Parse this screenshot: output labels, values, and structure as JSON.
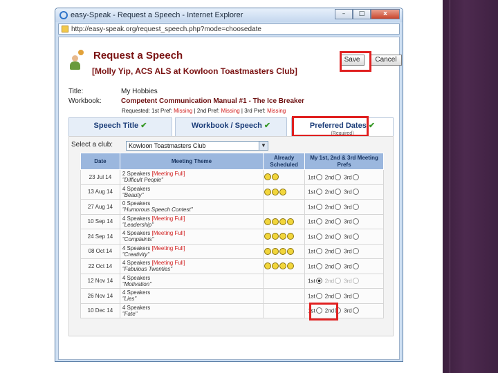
{
  "window": {
    "title": "easy-Speak - Request a Speech - Internet Explorer",
    "url": "http://easy-speak.org/request_speech.php?mode=choosedate",
    "buttons": {
      "minimize": "–",
      "maximize": "□",
      "close": "x"
    }
  },
  "header": {
    "title": "Request a Speech",
    "member": "[Molly Yip, ACS ALS at Kowloon Toastmasters Club]",
    "save_label": "Save",
    "cancel_label": "Cancel"
  },
  "info": {
    "title_label": "Title:",
    "title_value": "My Hobbies",
    "workbook_label": "Workbook:",
    "workbook_value": "Competent Communication Manual #1 - The Ice Breaker",
    "requested": {
      "prefix": "Requested: 1st Pref:",
      "first": "Missing",
      "second_label": "| 2nd Pref:",
      "second": "Missing",
      "third_label": "| 3rd Pref:",
      "third": "Missing"
    }
  },
  "tabs": [
    {
      "label": "Speech Title",
      "tick": "✔"
    },
    {
      "label": "Workbook / Speech",
      "tick": "✔"
    },
    {
      "label": "Preferred Dates",
      "tick": "✔",
      "sub": "(Required)"
    }
  ],
  "club": {
    "label": "Select a club:",
    "value": "Kowloon Toastmasters Club"
  },
  "table": {
    "headers": {
      "date": "Date",
      "theme": "Meeting Theme",
      "scheduled": "Already Scheduled",
      "prefs": "My 1st, 2nd & 3rd Meeting Prefs"
    },
    "pref_labels": [
      "1st",
      "2nd",
      "3rd"
    ],
    "rows": [
      {
        "date": "23 Jul 14",
        "speakers": "2 Speakers",
        "full": "[Meeting Full]",
        "theme": "\"Difficult People\"",
        "scheduled": 2,
        "selected": "",
        "disabled": false
      },
      {
        "date": "13 Aug 14",
        "speakers": "4 Speakers",
        "full": "",
        "theme": "\"Beauty\"",
        "scheduled": 3,
        "selected": "",
        "disabled": false
      },
      {
        "date": "27 Aug 14",
        "speakers": "0 Speakers",
        "full": "",
        "theme": "\"Humorous Speech Contest\"",
        "scheduled": 0,
        "selected": "",
        "disabled": false
      },
      {
        "date": "10 Sep 14",
        "speakers": "4 Speakers",
        "full": "[Meeting Full]",
        "theme": "\"Leadership\"",
        "scheduled": 4,
        "selected": "",
        "disabled": false
      },
      {
        "date": "24 Sep 14",
        "speakers": "4 Speakers",
        "full": "[Meeting Full]",
        "theme": "\"Complaints\"",
        "scheduled": 4,
        "selected": "",
        "disabled": false
      },
      {
        "date": "08 Oct 14",
        "speakers": "4 Speakers",
        "full": "[Meeting Full]",
        "theme": "\"Creativity\"",
        "scheduled": 4,
        "selected": "",
        "disabled": false
      },
      {
        "date": "22 Oct 14",
        "speakers": "4 Speakers",
        "full": "[Meeting Full]",
        "theme": "\"Fabulous Twenties\"",
        "scheduled": 4,
        "selected": "",
        "disabled": false
      },
      {
        "date": "12 Nov 14",
        "speakers": "4 Speakers",
        "full": "",
        "theme": "\"Motivation\"",
        "scheduled": 0,
        "selected": "1st",
        "disabled": true
      },
      {
        "date": "26 Nov 14",
        "speakers": "4 Speakers",
        "full": "",
        "theme": "\"Lies\"",
        "scheduled": 0,
        "selected": "",
        "disabled": false
      },
      {
        "date": "10 Dec 14",
        "speakers": "4 Speakers",
        "full": "",
        "theme": "\"Fate\"",
        "scheduled": 0,
        "selected": "",
        "disabled": false
      }
    ]
  },
  "colors": {
    "title": "#7a1212",
    "missing": "#d01c1c",
    "highlight": "#e02020",
    "header_bg": "#9bb7de",
    "tick": "#3a9a2a",
    "band": "#4d2a4f"
  }
}
